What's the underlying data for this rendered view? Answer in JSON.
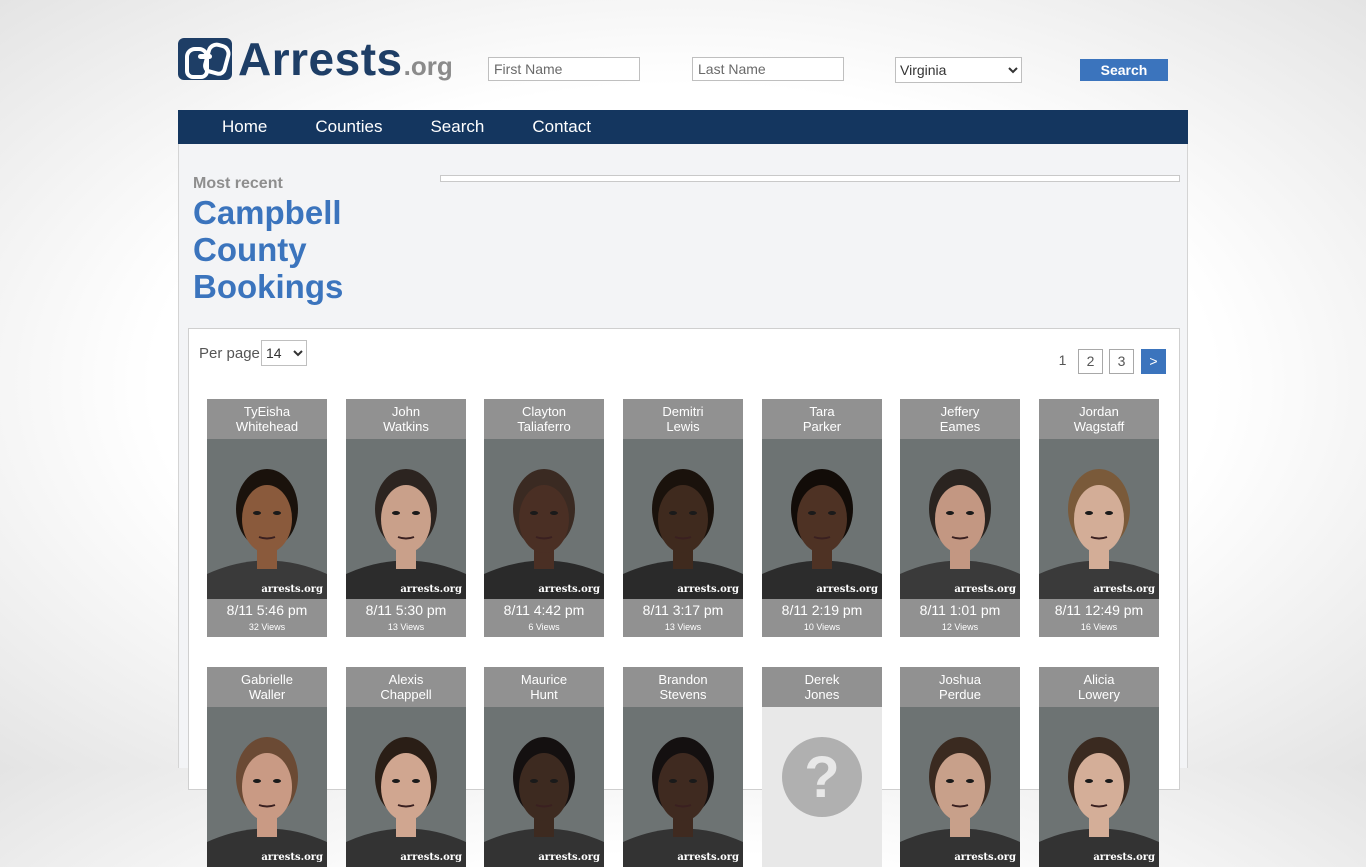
{
  "header": {
    "logo_main": "Arrests",
    "logo_ext": ".org",
    "first_name_placeholder": "First Name",
    "last_name_placeholder": "Last Name",
    "state_selected": "Virginia",
    "search_label": "Search"
  },
  "nav": [
    "Home",
    "Counties",
    "Search",
    "Contact"
  ],
  "intro": {
    "most_recent": "Most recent",
    "title_line1": "Campbell",
    "title_line2": "County",
    "title_line3": "Bookings"
  },
  "listing": {
    "per_page_label": "Per page",
    "per_page_value": "14",
    "pages": [
      "1",
      "2",
      "3",
      ">"
    ],
    "watermark": "arrests.org",
    "row1": [
      {
        "first": "TyEisha",
        "last": "Whitehead",
        "date": "8/11 5:46 pm",
        "views": "32 Views",
        "skin": "#8a5a3c",
        "hair": "#1a120c",
        "shirt": "#3a3a3a"
      },
      {
        "first": "John",
        "last": "Watkins",
        "date": "8/11 5:30 pm",
        "views": "13 Views",
        "skin": "#c9a08a",
        "hair": "#2c2420",
        "shirt": "#2c2c2c"
      },
      {
        "first": "Clayton",
        "last": "Taliaferro",
        "date": "8/11 4:42 pm",
        "views": "6 Views",
        "skin": "#4a2f24",
        "hair": "#3a2a22",
        "shirt": "#2a2a2a"
      },
      {
        "first": "Demitri",
        "last": "Lewis",
        "date": "8/11 3:17 pm",
        "views": "13 Views",
        "skin": "#3f2a1e",
        "hair": "#1a120c",
        "shirt": "#2a2a2a"
      },
      {
        "first": "Tara",
        "last": "Parker",
        "date": "8/11 2:19 pm",
        "views": "10 Views",
        "skin": "#4e3224",
        "hair": "#120c08",
        "shirt": "#2c2c2c"
      },
      {
        "first": "Jeffery",
        "last": "Eames",
        "date": "8/11 1:01 pm",
        "views": "12 Views",
        "skin": "#c39782",
        "hair": "#2a2420",
        "shirt": "#3a3a3a"
      },
      {
        "first": "Jordan",
        "last": "Wagstaff",
        "date": "8/11 12:49 pm",
        "views": "16 Views",
        "skin": "#d3ad97",
        "hair": "#7a5a3a",
        "shirt": "#3a3a3a"
      }
    ],
    "row2": [
      {
        "first": "Gabrielle",
        "last": "Waller",
        "skin": "#c99a84",
        "hair": "#6b4a34"
      },
      {
        "first": "Alexis",
        "last": "Chappell",
        "skin": "#d0a690",
        "hair": "#2a1e16"
      },
      {
        "first": "Maurice",
        "last": "Hunt",
        "skin": "#3d2a20",
        "hair": "#141010"
      },
      {
        "first": "Brandon",
        "last": "Stevens",
        "skin": "#3f2a20",
        "hair": "#141010"
      },
      {
        "first": "Derek",
        "last": "Jones",
        "placeholder_glyph": "?"
      },
      {
        "first": "Joshua",
        "last": "Perdue",
        "skin": "#c8a08a",
        "hair": "#3a2a20"
      },
      {
        "first": "Alicia",
        "last": "Lowery",
        "skin": "#d4ae98",
        "hair": "#3a2a20"
      }
    ],
    "colors": {
      "card_bg": "#919191",
      "accent": "#3b74bd",
      "nav": "#14365f",
      "photo_bg": "#6d7373"
    }
  }
}
